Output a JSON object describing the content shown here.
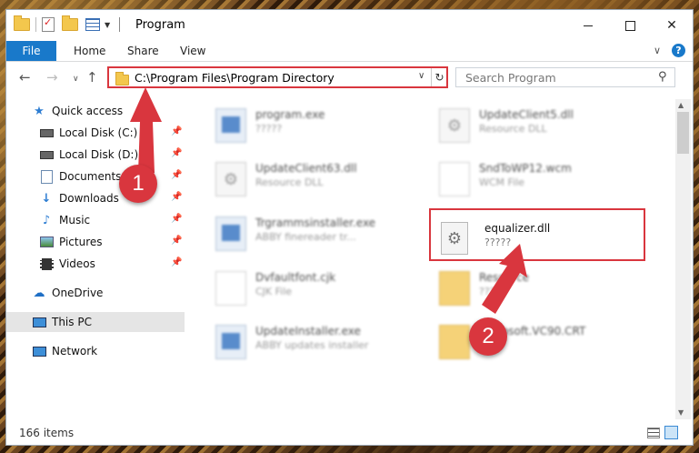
{
  "window": {
    "title": "Program",
    "ribbon_tabs": [
      "File",
      "Home",
      "Share",
      "View"
    ],
    "help_label": "?"
  },
  "address": {
    "path": "C:\\Program Files\\Program Directory",
    "search_placeholder": "Search Program"
  },
  "sidebar": {
    "items": [
      {
        "label": "Quick access",
        "icon": "star-icon"
      },
      {
        "label": "Local Disk (C:)",
        "icon": "drive-icon",
        "pinned": true
      },
      {
        "label": "Local Disk (D:)",
        "icon": "drive-icon",
        "pinned": true
      },
      {
        "label": "Documents",
        "icon": "documents-icon",
        "pinned": true
      },
      {
        "label": "Downloads",
        "icon": "download-arrow-icon",
        "pinned": true
      },
      {
        "label": "Music",
        "icon": "music-note-icon",
        "pinned": true
      },
      {
        "label": "Pictures",
        "icon": "pictures-icon",
        "pinned": true
      },
      {
        "label": "Videos",
        "icon": "film-icon",
        "pinned": true
      },
      {
        "label": "OneDrive",
        "icon": "cloud-icon"
      },
      {
        "label": "This PC",
        "icon": "computer-icon",
        "selected": true
      },
      {
        "label": "Network",
        "icon": "network-icon"
      }
    ]
  },
  "files": [
    {
      "name": "program.exe",
      "desc": "?????",
      "icon": "exe-icon",
      "blurred": true
    },
    {
      "name": "UpdateClient5.dll",
      "desc": "Resource DLL",
      "icon": "dll-icon",
      "blurred": true
    },
    {
      "name": "UpdateClient63.dll",
      "desc": "Resource DLL",
      "icon": "dll-icon",
      "blurred": true
    },
    {
      "name": "SndToWP12.wcm",
      "desc": "WCM File",
      "icon": "file-icon",
      "blurred": true
    },
    {
      "name": "Trgrammsinstaller.exe",
      "desc": "ABBY finereader tr...",
      "icon": "exe-icon",
      "blurred": true
    },
    {
      "name": "equalizer.dll",
      "desc": "?????",
      "icon": "dll-gear-icon",
      "blurred": false
    },
    {
      "name": "Dvfaultfont.cjk",
      "desc": "CJK File",
      "icon": "file-icon",
      "blurred": true
    },
    {
      "name": "Resource",
      "desc": "????",
      "icon": "folder-icon",
      "blurred": true
    },
    {
      "name": "UpdateInstaller.exe",
      "desc": "ABBY updates installer",
      "icon": "exe-icon",
      "blurred": true
    },
    {
      "name": "Microsoft.VC90.CRT",
      "desc": "",
      "icon": "folder-icon",
      "blurred": true
    }
  ],
  "status": {
    "item_count": "166 items"
  },
  "annotations": {
    "step1": "1",
    "step2": "2",
    "accent": "#d9363e"
  }
}
